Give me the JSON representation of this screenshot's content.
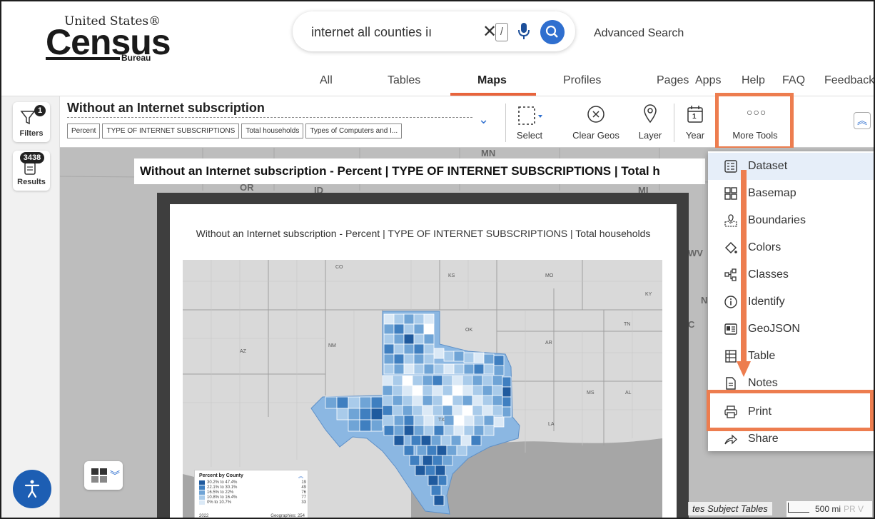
{
  "header": {
    "logo": {
      "top": "United States®",
      "main": "Census",
      "sub": "Bureau"
    },
    "search": {
      "query": "internet all counties iı",
      "slash_key": "/"
    },
    "advanced_search": "Advanced Search",
    "nav": [
      {
        "label": "All"
      },
      {
        "label": "Tables"
      },
      {
        "label": "Maps"
      },
      {
        "label": "Profiles"
      },
      {
        "label": "Pages"
      },
      {
        "label": "Apps"
      },
      {
        "label": "Help"
      },
      {
        "label": "FAQ"
      },
      {
        "label": "Feedback"
      }
    ],
    "active_nav": "Maps"
  },
  "rail": {
    "filters": {
      "label": "Filters",
      "count": "1"
    },
    "results": {
      "label": "Results",
      "count": "3438"
    }
  },
  "toolbar": {
    "title": "Without an Internet subscription",
    "chips": [
      "Percent",
      "TYPE OF INTERNET SUBSCRIPTIONS",
      "Total households",
      "Types of Computers and I..."
    ],
    "tools": {
      "select": "Select",
      "clear_geos": "Clear Geos",
      "layer": "Layer",
      "year": "Year",
      "year_icon_text": "1",
      "more_tools": "More Tools"
    }
  },
  "map": {
    "title_strip": "Without an Internet subscription - Percent | TYPE OF INTERNET SUBSCRIPTIONS | Total h",
    "print_title": "Without an Internet subscription - Percent | TYPE OF INTERNET SUBSCRIPTIONS | Total households",
    "background_labels": [
      "MN",
      "OR",
      "ID",
      "MI",
      "WV",
      "N",
      "C"
    ],
    "state_labels": [
      "CO",
      "KS",
      "MO",
      "KY",
      "OK",
      "AZ",
      "NM",
      "TN",
      "AR",
      "MS",
      "AL",
      "TX",
      "LA"
    ],
    "legend": {
      "title": "Percent by County",
      "rows": [
        {
          "label": "30.2% to 47.4%",
          "count": "19",
          "color": "#1f5a9e"
        },
        {
          "label": "22.1% to 30.1%",
          "count": "49",
          "color": "#3f7fc0"
        },
        {
          "label": "16.5% to 22%",
          "count": "76",
          "color": "#6fa4d6"
        },
        {
          "label": "10.8% to 16.4%",
          "count": "77",
          "color": "#a9cbea"
        },
        {
          "label": "0% to 10.7%",
          "count": "33",
          "color": "#dbe9f6"
        }
      ],
      "year": "2022",
      "geographies": "Geographies: 254"
    },
    "attribution": "tes Subject Tables",
    "scale": "500 mi",
    "scale_trail": "PR V"
  },
  "more_tools_menu": [
    {
      "label": "Dataset",
      "icon": "dataset-icon"
    },
    {
      "label": "Basemap",
      "icon": "basemap-icon"
    },
    {
      "label": "Boundaries",
      "icon": "boundaries-icon"
    },
    {
      "label": "Colors",
      "icon": "colors-icon"
    },
    {
      "label": "Classes",
      "icon": "classes-icon"
    },
    {
      "label": "Identify",
      "icon": "identify-icon"
    },
    {
      "label": "GeoJSON",
      "icon": "geojson-icon"
    },
    {
      "label": "Table",
      "icon": "table-icon"
    },
    {
      "label": "Notes",
      "icon": "notes-icon"
    },
    {
      "label": "Print",
      "icon": "print-icon"
    },
    {
      "label": "Share",
      "icon": "share-icon"
    }
  ],
  "colors": {
    "accent": "#2f6fcf",
    "highlight": "#ed7d4f",
    "active_tab": "#e8643c",
    "texas_dark": "#1f5a9e",
    "texas_light": "#dbe9f6"
  }
}
